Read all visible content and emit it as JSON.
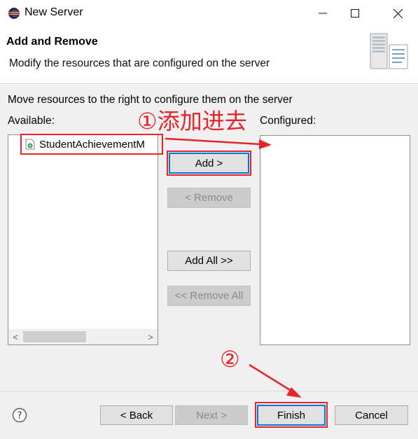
{
  "window": {
    "title": "New Server",
    "minimize_symbol": "—",
    "maximize_symbol": "☐",
    "close_symbol": "✕"
  },
  "header": {
    "title": "Add and Remove",
    "description": "Modify the resources that are configured on the server"
  },
  "body": {
    "instruction": "Move resources to the right to configure them on the server",
    "available_label": "Available:",
    "configured_label": "Configured:",
    "available_items": [
      "StudentAchievementM"
    ],
    "configured_items": []
  },
  "buttons": {
    "add": "Add >",
    "remove": "< Remove",
    "add_all": "Add All >>",
    "remove_all": "<< Remove All",
    "back": "< Back",
    "next": "Next >",
    "finish": "Finish",
    "cancel": "Cancel"
  },
  "scrollbar": {
    "left_arrow": "<",
    "right_arrow": ">"
  },
  "annotations": {
    "step1": "①添加进去",
    "step2": "②"
  },
  "colors": {
    "annotation": "#e8232a",
    "accent": "#0078d7",
    "panel": "#f0f0f0"
  },
  "icons": [
    "eclipse-app-icon",
    "wizard-server-graphic",
    "web-module-icon",
    "help-icon"
  ]
}
